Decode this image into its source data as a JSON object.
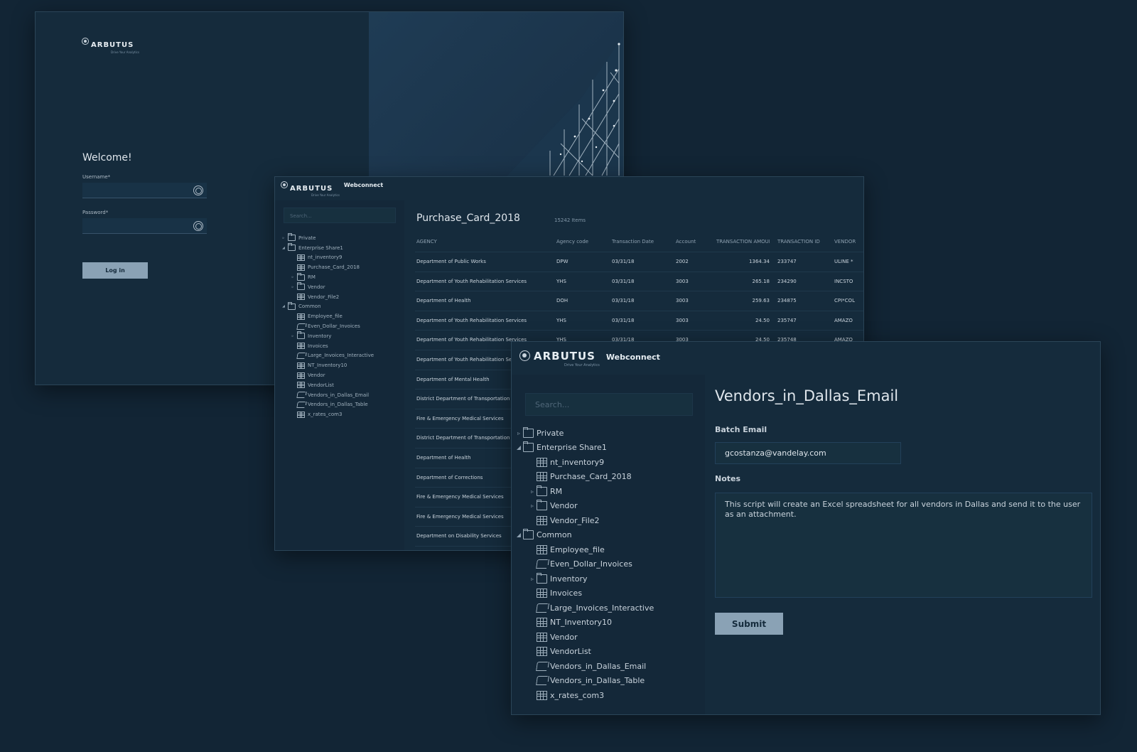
{
  "login": {
    "brand": "ARBUTUS",
    "tagline": "Drive Your Analytics",
    "welcome": "Welcome!",
    "username_label": "Username*",
    "password_label": "Password*",
    "login_button": "Log in"
  },
  "table_window": {
    "brand": "ARBUTUS",
    "tagline": "Drive Your Analytics",
    "product": "Webconnect",
    "search_placeholder": "Search...",
    "title": "Purchase_Card_2018",
    "count": "15242 Items",
    "columns": [
      "AGENCY",
      "Agency code",
      "Transaction Date",
      "Account",
      "TRANSACTION AMOUNT",
      "TRANSACTION ID",
      "VENDOR"
    ],
    "rows": [
      [
        "Department of Public Works",
        "DPW",
        "03/31/18",
        "2002",
        "1364.34",
        "233747",
        "ULINE *"
      ],
      [
        "Department of Youth Rehabilitation Services",
        "YHS",
        "03/31/18",
        "3003",
        "265.18",
        "234290",
        "INCSTO"
      ],
      [
        "Department of Health",
        "DOH",
        "03/31/18",
        "3003",
        "259.63",
        "234875",
        "CPI*COL"
      ],
      [
        "Department of Youth Rehabilitation Services",
        "YHS",
        "03/31/18",
        "3003",
        "24.50",
        "235747",
        "AMAZO"
      ],
      [
        "Department of Youth Rehabilitation Services",
        "YHS",
        "03/31/18",
        "3003",
        "24.50",
        "235748",
        "AMAZO"
      ],
      [
        "Department of Youth Rehabilitation Services",
        "",
        "",
        "",
        "",
        "",
        ""
      ],
      [
        "Department of Mental Health",
        "",
        "",
        "",
        "",
        "",
        ""
      ],
      [
        "District Department of Transportation",
        "",
        "",
        "",
        "",
        "",
        ""
      ],
      [
        "Fire & Emergency Medical Services",
        "",
        "",
        "",
        "",
        "",
        ""
      ],
      [
        "District Department of Transportation",
        "",
        "",
        "",
        "",
        "",
        ""
      ],
      [
        "Department of Health",
        "",
        "",
        "",
        "",
        "",
        ""
      ],
      [
        "Department of Corrections",
        "",
        "",
        "",
        "",
        "",
        ""
      ],
      [
        "Fire & Emergency Medical Services",
        "",
        "",
        "",
        "",
        "",
        ""
      ],
      [
        "Fire & Emergency Medical Services",
        "",
        "",
        "",
        "",
        "",
        ""
      ],
      [
        "Department on Disability Services",
        "",
        "",
        "",
        "",
        "",
        ""
      ]
    ]
  },
  "tree": [
    {
      "label": "Private",
      "type": "folder",
      "depth": 0,
      "toggle": "▹"
    },
    {
      "label": "Enterprise Share1",
      "type": "folder",
      "depth": 0,
      "toggle": "◢"
    },
    {
      "label": "nt_inventory9",
      "type": "table",
      "depth": 1,
      "toggle": ""
    },
    {
      "label": "Purchase_Card_2018",
      "type": "table",
      "depth": 1,
      "toggle": ""
    },
    {
      "label": "RM",
      "type": "folder",
      "depth": 1,
      "toggle": "▹"
    },
    {
      "label": "Vendor",
      "type": "folder",
      "depth": 1,
      "toggle": "▹"
    },
    {
      "label": "Vendor_File2",
      "type": "table",
      "depth": 1,
      "toggle": ""
    },
    {
      "label": "Common",
      "type": "folder",
      "depth": 0,
      "toggle": "◢"
    },
    {
      "label": "Employee_file",
      "type": "table",
      "depth": 1,
      "toggle": ""
    },
    {
      "label": "Even_Dollar_Invoices",
      "type": "script",
      "depth": 1,
      "toggle": ""
    },
    {
      "label": "Inventory",
      "type": "folder",
      "depth": 1,
      "toggle": "▹"
    },
    {
      "label": "Invoices",
      "type": "table",
      "depth": 1,
      "toggle": ""
    },
    {
      "label": "Large_Invoices_Interactive",
      "type": "script",
      "depth": 1,
      "toggle": ""
    },
    {
      "label": "NT_Inventory10",
      "type": "table",
      "depth": 1,
      "toggle": ""
    },
    {
      "label": "Vendor",
      "type": "table",
      "depth": 1,
      "toggle": ""
    },
    {
      "label": "VendorList",
      "type": "table",
      "depth": 1,
      "toggle": ""
    },
    {
      "label": "Vendors_in_Dallas_Email",
      "type": "script",
      "depth": 1,
      "toggle": ""
    },
    {
      "label": "Vendors_in_Dallas_Table",
      "type": "script",
      "depth": 1,
      "toggle": ""
    },
    {
      "label": "x_rates_com3",
      "type": "table",
      "depth": 1,
      "toggle": ""
    }
  ],
  "form_window": {
    "brand": "ARBUTUS",
    "tagline": "Drive Your Analytics",
    "product": "Webconnect",
    "search_placeholder": "Search...",
    "title": "Vendors_in_Dallas_Email",
    "batch_email_label": "Batch Email",
    "batch_email_value": "gcostanza@vandelay.com",
    "notes_label": "Notes",
    "notes_value": "This script will create an Excel spreadsheet for all vendors in Dallas and send it to the user as an attachment.",
    "submit_button": "Submit"
  }
}
